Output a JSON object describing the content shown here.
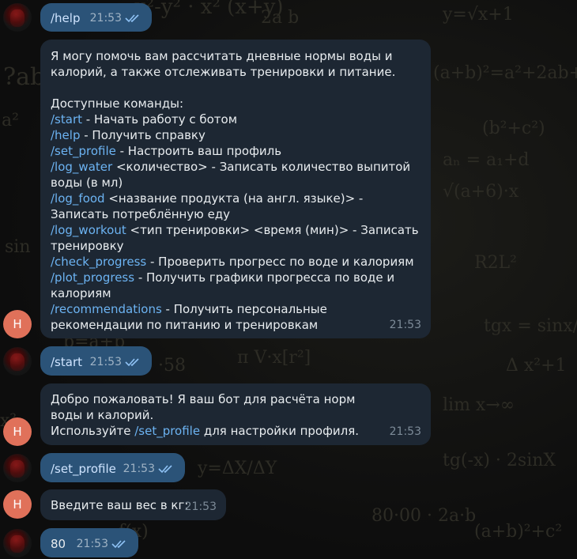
{
  "chat": {
    "bot_avatar_letter": "H",
    "messages": [
      {
        "id": "m1",
        "direction": "out",
        "text": "/help",
        "time": "21:53"
      },
      {
        "id": "m2",
        "direction": "in",
        "time": "21:53",
        "intro": "Я могу помочь вам рассчитать дневные нормы воды и калорий, а также отслеживать тренировки и питание.",
        "heading": "Доступные команды:",
        "commands": [
          {
            "cmd": "/start",
            "desc": " - Начать работу с ботом"
          },
          {
            "cmd": "/help",
            "desc": " - Получить справку"
          },
          {
            "cmd": "/set_profile",
            "desc": " - Настроить ваш профиль"
          },
          {
            "cmd": "/log_water",
            "desc": " <количество> - Записать количество выпитой воды (в мл)"
          },
          {
            "cmd": "/log_food",
            "desc": " <название продукта (на англ. языке)> - Записать потреблённую еду"
          },
          {
            "cmd": "/log_workout",
            "desc": " <тип тренировки> <время (мин)> - Записать тренировку"
          },
          {
            "cmd": "/check_progress",
            "desc": " - Проверить прогресс по воде и калориям"
          },
          {
            "cmd": "/plot_progress",
            "desc": " - Получить графики прогресса по воде и калориям"
          },
          {
            "cmd": "/recommendations",
            "desc": " - Получить персональные рекомендации по питанию и тренировкам"
          }
        ]
      },
      {
        "id": "m3",
        "direction": "out",
        "text": "/start",
        "time": "21:53"
      },
      {
        "id": "m4",
        "direction": "in",
        "time": "21:53",
        "line1": "Добро пожаловать! Я ваш бот для расчёта норм воды и калорий.",
        "line2_prefix": "Используйте ",
        "line2_cmd": "/set_profile",
        "line2_suffix": " для настройки профиля."
      },
      {
        "id": "m5",
        "direction": "out",
        "text": "/set_profile",
        "time": "21:53"
      },
      {
        "id": "m6",
        "direction": "in",
        "text": "Введите ваш вес в кг:",
        "time": "21:53"
      },
      {
        "id": "m7",
        "direction": "out",
        "text": "80",
        "time": "21:53"
      }
    ]
  },
  "colors": {
    "outgoing_bubble": "#2b5378",
    "incoming_bubble": "#1d2733",
    "command_link": "#6cb3f2",
    "bot_avatar": "#e0715a"
  }
}
